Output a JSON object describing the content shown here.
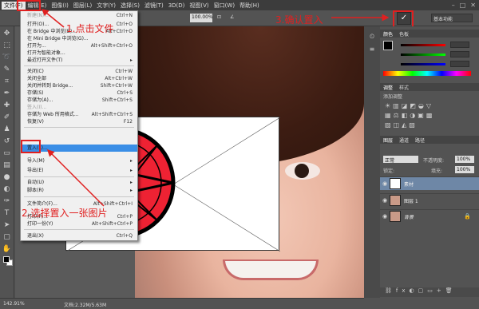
{
  "menubar": {
    "items": [
      "文件(F)",
      "编辑(E)",
      "图像(I)",
      "图层(L)",
      "文字(Y)",
      "选择(S)",
      "滤镜(T)",
      "3D(D)",
      "视图(V)",
      "窗口(W)",
      "帮助(H)"
    ]
  },
  "options": {
    "zoom_value": "100.00%",
    "commit_label": "✓",
    "workspace": "基本功能"
  },
  "file_menu": {
    "items": [
      {
        "label": "新建(N)...",
        "shortcut": "Ctrl+N"
      },
      {
        "label": "打开(O)...",
        "shortcut": "Ctrl+O"
      },
      {
        "label": "在 Bridge 中浏览(B)...",
        "shortcut": "Alt+Ctrl+O"
      },
      {
        "label": "在 Mini Bridge 中浏览(G)...",
        "shortcut": ""
      },
      {
        "label": "打开为...",
        "shortcut": "Alt+Shift+Ctrl+O"
      },
      {
        "label": "打开为智能对象...",
        "shortcut": ""
      },
      {
        "label": "最近打开文件(T)",
        "shortcut": ""
      },
      {
        "label": "关闭(C)",
        "shortcut": "Ctrl+W"
      },
      {
        "label": "关闭全部",
        "shortcut": "Alt+Ctrl+W"
      },
      {
        "label": "关闭并转到 Bridge...",
        "shortcut": "Shift+Ctrl+W"
      },
      {
        "label": "存储(S)",
        "shortcut": "Ctrl+S"
      },
      {
        "label": "存储为(A)...",
        "shortcut": "Shift+Ctrl+S"
      },
      {
        "label": "签入(I)...",
        "shortcut": ""
      },
      {
        "label": "存储为 Web 所用格式...",
        "shortcut": "Alt+Shift+Ctrl+S"
      },
      {
        "label": "恢复(V)",
        "shortcut": "F12"
      },
      {
        "label": "置入(L)...",
        "shortcut": ""
      },
      {
        "label": "导入(M)",
        "shortcut": ""
      },
      {
        "label": "导出(E)",
        "shortcut": ""
      },
      {
        "label": "自动(U)",
        "shortcut": ""
      },
      {
        "label": "脚本(R)",
        "shortcut": ""
      },
      {
        "label": "文件简介(F)...",
        "shortcut": "Alt+Shift+Ctrl+I"
      },
      {
        "label": "打印(P)...",
        "shortcut": "Ctrl+P"
      },
      {
        "label": "打印一份(Y)",
        "shortcut": "Alt+Shift+Ctrl+P"
      },
      {
        "label": "退出(X)",
        "shortcut": "Ctrl+Q"
      }
    ]
  },
  "annotations": {
    "step1": "1.点击文件",
    "step2": "2.选择置入一张图片",
    "step3": "3.确认置入"
  },
  "panels": {
    "color_tabs": [
      "颜色",
      "色板"
    ],
    "adjust_tabs": [
      "调整",
      "样式"
    ],
    "adjust_title": "添加调整",
    "layer_tabs": [
      "图层",
      "通道",
      "路径"
    ],
    "blend_mode": "正常",
    "opacity_label": "不透明度:",
    "opacity_value": "100%",
    "lock_label": "锁定:",
    "fill_label": "填充:",
    "fill_value": "100%",
    "layers": [
      {
        "name": "素材",
        "selected": true
      },
      {
        "name": "图层 1",
        "selected": false
      },
      {
        "name": "背景",
        "selected": false
      }
    ]
  },
  "status": {
    "zoom": "142.91%",
    "doc": "文档:2.32M/5.63M"
  },
  "colors": {
    "annotation_red": "#e02020",
    "menu_highlight": "#3a8ee6",
    "emblem_red": "#ee2233"
  }
}
